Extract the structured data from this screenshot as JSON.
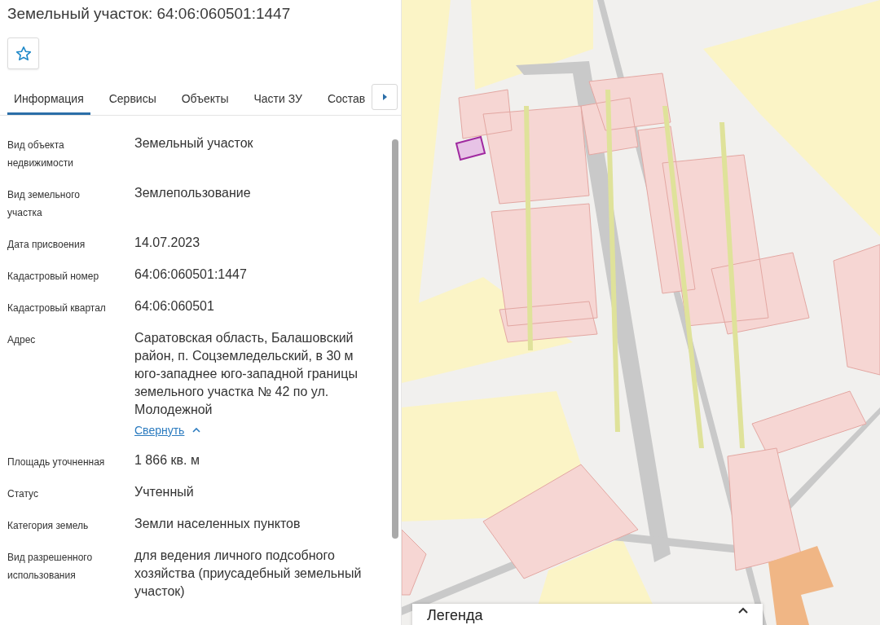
{
  "title": "Земельный участок: 64:06:060501:1447",
  "favorite": {
    "starred": false
  },
  "tabs": [
    {
      "label": "Информация",
      "selected": true
    },
    {
      "label": "Сервисы",
      "selected": false
    },
    {
      "label": "Объекты",
      "selected": false
    },
    {
      "label": "Части ЗУ",
      "selected": false
    },
    {
      "label": "Состав",
      "selected": false
    }
  ],
  "properties": [
    {
      "label": "Вид объекта недвижимости",
      "value": "Земельный участок"
    },
    {
      "label": "Вид земельного участка",
      "value": "Землепользование"
    },
    {
      "label": "Дата присвоения",
      "value": "14.07.2023"
    },
    {
      "label": "Кадастровый номер",
      "value": "64:06:060501:1447"
    },
    {
      "label": "Кадастровый квартал",
      "value": "64:06:060501"
    },
    {
      "label": "Адрес",
      "value": "Саратовская область, Балашовский район, п. Соцземледельский, в 30 м юго-западнее юго-западной границы земельного участка № 42 по ул. Молодежной",
      "link": "Свернуть"
    },
    {
      "label": "Площадь уточненная",
      "value": "1 866 кв. м"
    },
    {
      "label": "Статус",
      "value": "Учтенный"
    },
    {
      "label": "Категория земель",
      "value": "Земли населенных пунктов"
    },
    {
      "label": "Вид разрешенного использования",
      "value": "для ведения личного подсобного хозяйства (приусадебный земельный участок)"
    }
  ],
  "map": {
    "kind": "picture",
    "legend": {
      "title": "Легенда"
    }
  }
}
